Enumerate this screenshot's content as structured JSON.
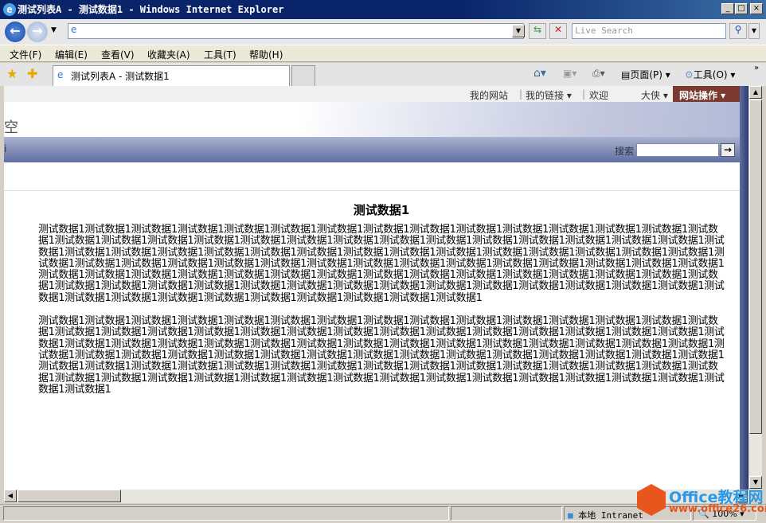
{
  "window": {
    "title": "测试列表A - 测试数据1 - Windows Internet Explorer",
    "controls": [
      "_",
      "□",
      "×"
    ]
  },
  "navbar": {
    "address_value": "",
    "search_placeholder": "Live Search"
  },
  "menu": [
    "文件(F)",
    "编辑(E)",
    "查看(V)",
    "收藏夹(A)",
    "工具(T)",
    "帮助(H)"
  ],
  "tab": {
    "label": "测试列表A - 测试数据1"
  },
  "command_bar": {
    "page": "页面(P)",
    "tools": "工具(O)",
    "more": "»"
  },
  "site": {
    "top_links": [
      "我的网站",
      "我的链接 ▾",
      "欢迎"
    ],
    "user": "大侠 ▾",
    "site_actions": "网站操作 ▾",
    "title_fragment": "空",
    "nav_fragment": "i",
    "search_label": "搜索",
    "search_value": ""
  },
  "content": {
    "heading": "测试数据1",
    "paragraphs": [
      "测试数据1测试数据1测试数据1测试数据1测试数据1测试数据1测试数据1测试数据1测试数据1测试数据1测试数据1测试数据1测试数据1测试数据1测试数据1测试数据1测试数据1测试数据1测试数据1测试数据1测试数据1测试数据1测试数据1测试数据1测试数据1测试数据1测试数据1测试数据1测试数据1测试数据1测试数据1测试数据1测试数据1测试数据1测试数据1测试数据1测试数据1测试数据1测试数据1测试数据1测试数据1测试数据1测试数据1测试数据1测试数据1测试数据1测试数据1测试数据1测试数据1测试数据1测试数据1测试数据1测试数据1测试数据1测试数据1测试数据1测试数据1测试数据1测试数据1测试数据1测试数据1测试数据1测试数据1测试数据1测试数据1测试数据1测试数据1测试数据1测试数据1测试数据1测试数据1测试数据1测试数据1测试数据1测试数据1测试数据1测试数据1测试数据1测试数据1测试数据1测试数据1测试数据1测试数据1测试数据1测试数据1测试数据1测试数据1测试数据1测试数据1测试数据1测试数据1测试数据1测试数据1测试数据1测试数据1测试数据1测试数据1测试数据1",
      "测试数据1测试数据1测试数据1测试数据1测试数据1测试数据1测试数据1测试数据1测试数据1测试数据1测试数据1测试数据1测试数据1测试数据1测试数据1测试数据1测试数据1测试数据1测试数据1测试数据1测试数据1测试数据1测试数据1测试数据1测试数据1测试数据1测试数据1测试数据1测试数据1测试数据1测试数据1测试数据1测试数据1测试数据1测试数据1测试数据1测试数据1测试数据1测试数据1测试数据1测试数据1测试数据1测试数据1测试数据1测试数据1测试数据1测试数据1测试数据1测试数据1测试数据1测试数据1测试数据1测试数据1测试数据1测试数据1测试数据1测试数据1测试数据1测试数据1测试数据1测试数据1测试数据1测试数据1测试数据1测试数据1测试数据1测试数据1测试数据1测试数据1测试数据1测试数据1测试数据1测试数据1测试数据1测试数据1测试数据1测试数据1测试数据1测试数据1测试数据1测试数据1测试数据1测试数据1测试数据1测试数据1测试数据1测试数据1测试数据1测试数据1测试数据1"
    ]
  },
  "status": {
    "zone": "本地 Intranet",
    "zoom": "100%"
  },
  "watermark": {
    "line1": "Office教程网",
    "line2": "www.office26.com"
  },
  "colors": {
    "title_bar": "#0a246a",
    "site_actions": "#7a3a30",
    "nav_bar": "#5f6fa2"
  }
}
